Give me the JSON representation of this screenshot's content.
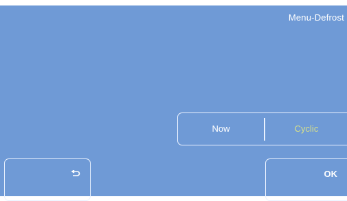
{
  "screen": {
    "title": "Menu-Defrost",
    "background_color": "#6f9ad6"
  },
  "defrost_mode": {
    "options": [
      {
        "label": "Now",
        "color": "#ffffff",
        "selected": false
      },
      {
        "label": "Cyclic",
        "color": "#d7e08a",
        "selected": true
      }
    ]
  },
  "buttons": {
    "back_icon": "return-arrow-icon",
    "ok_label": "OK"
  }
}
